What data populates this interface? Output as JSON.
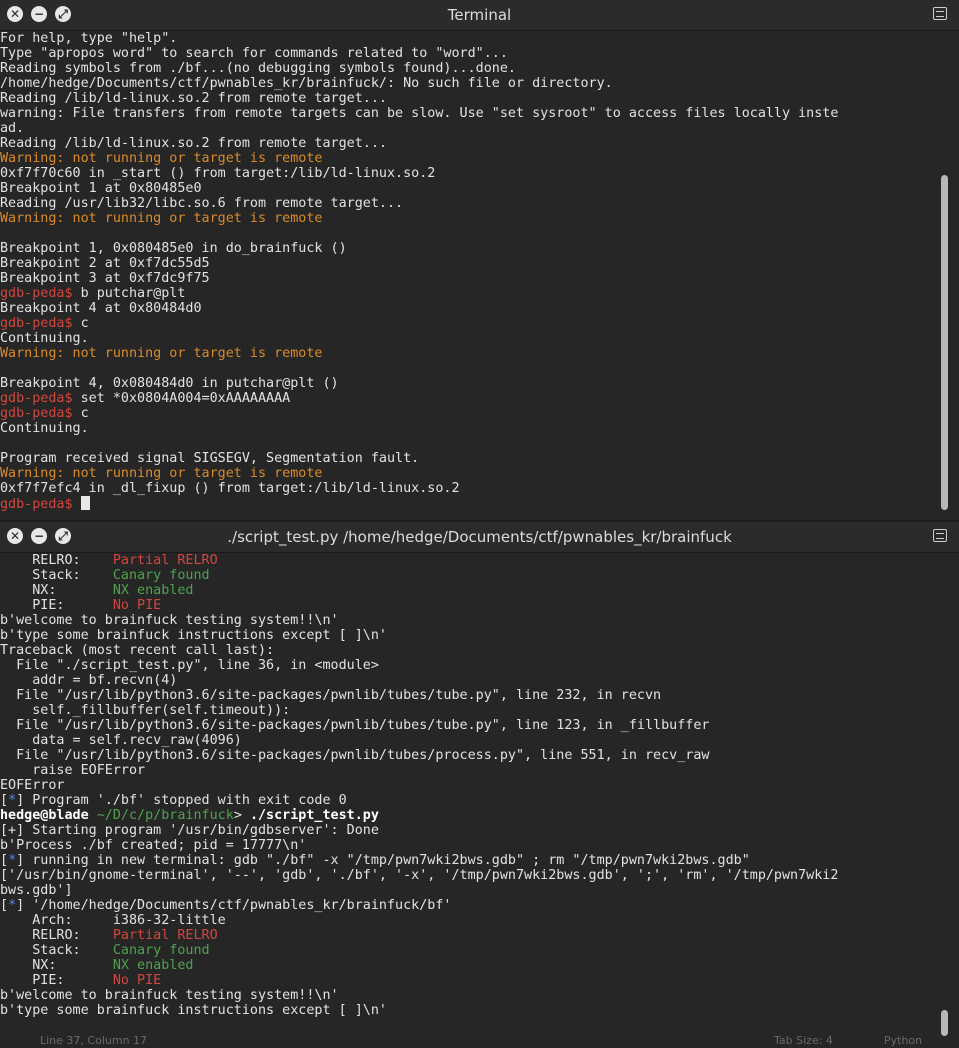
{
  "window1": {
    "title": "Terminal",
    "lines": [
      [
        [
          "w",
          "For help, type \"help\"."
        ]
      ],
      [
        [
          "w",
          "Type \"apropos word\" to search for commands related to \"word\"..."
        ]
      ],
      [
        [
          "w",
          "Reading symbols from ./bf...(no debugging symbols found)...done."
        ]
      ],
      [
        [
          "w",
          "/home/hedge/Documents/ctf/pwnables_kr/brainfuck/: No such file or directory."
        ]
      ],
      [
        [
          "w",
          "Reading /lib/ld-linux.so.2 from remote target..."
        ]
      ],
      [
        [
          "w",
          "warning: File transfers from remote targets can be slow. Use \"set sysroot\" to access files locally inste"
        ]
      ],
      [
        [
          "w",
          "ad."
        ]
      ],
      [
        [
          "w",
          "Reading /lib/ld-linux.so.2 from remote target..."
        ]
      ],
      [
        [
          "o",
          "Warning: not running or target is remote"
        ]
      ],
      [
        [
          "w",
          "0xf7f70c60 in _start () from target:/lib/ld-linux.so.2"
        ]
      ],
      [
        [
          "w",
          "Breakpoint 1 at 0x80485e0"
        ]
      ],
      [
        [
          "w",
          "Reading /usr/lib32/libc.so.6 from remote target..."
        ]
      ],
      [
        [
          "o",
          "Warning: not running or target is remote"
        ]
      ],
      [
        [
          "w",
          ""
        ]
      ],
      [
        [
          "w",
          "Breakpoint 1, 0x080485e0 in do_brainfuck ()"
        ]
      ],
      [
        [
          "w",
          "Breakpoint 2 at 0xf7dc55d5"
        ]
      ],
      [
        [
          "w",
          "Breakpoint 3 at 0xf7dc9f75"
        ]
      ],
      [
        [
          "r",
          "gdb-peda$ "
        ],
        [
          "w",
          "b putchar@plt"
        ]
      ],
      [
        [
          "w",
          "Breakpoint 4 at 0x80484d0"
        ]
      ],
      [
        [
          "r",
          "gdb-peda$ "
        ],
        [
          "w",
          "c"
        ]
      ],
      [
        [
          "w",
          "Continuing."
        ]
      ],
      [
        [
          "o",
          "Warning: not running or target is remote"
        ]
      ],
      [
        [
          "w",
          ""
        ]
      ],
      [
        [
          "w",
          "Breakpoint 4, 0x080484d0 in putchar@plt ()"
        ]
      ],
      [
        [
          "r",
          "gdb-peda$ "
        ],
        [
          "w",
          "set *0x0804A004=0xAAAAAAAA"
        ]
      ],
      [
        [
          "r",
          "gdb-peda$ "
        ],
        [
          "w",
          "c"
        ]
      ],
      [
        [
          "w",
          "Continuing."
        ]
      ],
      [
        [
          "w",
          ""
        ]
      ],
      [
        [
          "w",
          "Program received signal SIGSEGV, Segmentation fault."
        ]
      ],
      [
        [
          "o",
          "Warning: not running or target is remote"
        ]
      ],
      [
        [
          "w",
          "0xf7f7efc4 in _dl_fixup () from target:/lib/ld-linux.so.2"
        ]
      ],
      [
        [
          "r",
          "gdb-peda$ "
        ]
      ]
    ]
  },
  "window2": {
    "title": "./script_test.py  /home/hedge/Documents/ctf/pwnables_kr/brainfuck",
    "lines": [
      [
        [
          "w",
          "    RELRO:    "
        ],
        [
          "r",
          "Partial RELRO"
        ]
      ],
      [
        [
          "w",
          "    Stack:    "
        ],
        [
          "g",
          "Canary found"
        ]
      ],
      [
        [
          "w",
          "    NX:       "
        ],
        [
          "g",
          "NX enabled"
        ]
      ],
      [
        [
          "w",
          "    PIE:      "
        ],
        [
          "r",
          "No PIE"
        ]
      ],
      [
        [
          "w",
          "b'welcome to brainfuck testing system!!\\n'"
        ]
      ],
      [
        [
          "w",
          "b'type some brainfuck instructions except [ ]\\n'"
        ]
      ],
      [
        [
          "w",
          "Traceback (most recent call last):"
        ]
      ],
      [
        [
          "w",
          "  File \"./script_test.py\", line 36, in <module>"
        ]
      ],
      [
        [
          "w",
          "    addr = bf.recvn(4)"
        ]
      ],
      [
        [
          "w",
          "  File \"/usr/lib/python3.6/site-packages/pwnlib/tubes/tube.py\", line 232, in recvn"
        ]
      ],
      [
        [
          "w",
          "    self._fillbuffer(self.timeout)):"
        ]
      ],
      [
        [
          "w",
          "  File \"/usr/lib/python3.6/site-packages/pwnlib/tubes/tube.py\", line 123, in _fillbuffer"
        ]
      ],
      [
        [
          "w",
          "    data = self.recv_raw(4096)"
        ]
      ],
      [
        [
          "w",
          "  File \"/usr/lib/python3.6/site-packages/pwnlib/tubes/process.py\", line 551, in recv_raw"
        ]
      ],
      [
        [
          "w",
          "    raise EOFError"
        ]
      ],
      [
        [
          "w",
          "EOFError"
        ]
      ],
      [
        [
          "w",
          "["
        ],
        [
          "b",
          "*"
        ],
        [
          "w",
          "] Program './bf' stopped with exit code 0"
        ]
      ],
      [
        [
          "bold",
          "hedge@blade "
        ],
        [
          "g",
          "~/D/c/p/brainfuck"
        ],
        [
          "w",
          "> "
        ],
        [
          "bold",
          "./script_test.py"
        ]
      ],
      [
        [
          "w",
          "[+] Starting program '/usr/bin/gdbserver': Done"
        ]
      ],
      [
        [
          "w",
          "b'Process ./bf created; pid = 17777\\n'"
        ]
      ],
      [
        [
          "w",
          "["
        ],
        [
          "b",
          "*"
        ],
        [
          "w",
          "] running in new terminal: gdb \"./bf\" -x \"/tmp/pwn7wki2bws.gdb\" ; rm \"/tmp/pwn7wki2bws.gdb\""
        ]
      ],
      [
        [
          "w",
          "['/usr/bin/gnome-terminal', '--', 'gdb', './bf', '-x', '/tmp/pwn7wki2bws.gdb', ';', 'rm', '/tmp/pwn7wki2"
        ]
      ],
      [
        [
          "w",
          "bws.gdb']"
        ]
      ],
      [
        [
          "w",
          "["
        ],
        [
          "b",
          "*"
        ],
        [
          "w",
          "] '/home/hedge/Documents/ctf/pwnables_kr/brainfuck/bf'"
        ]
      ],
      [
        [
          "w",
          "    Arch:     i386-32-little"
        ]
      ],
      [
        [
          "w",
          "    RELRO:    "
        ],
        [
          "r",
          "Partial RELRO"
        ]
      ],
      [
        [
          "w",
          "    Stack:    "
        ],
        [
          "g",
          "Canary found"
        ]
      ],
      [
        [
          "w",
          "    NX:       "
        ],
        [
          "g",
          "NX enabled"
        ]
      ],
      [
        [
          "w",
          "    PIE:      "
        ],
        [
          "r",
          "No PIE"
        ]
      ],
      [
        [
          "w",
          "b'welcome to brainfuck testing system!!\\n'"
        ]
      ],
      [
        [
          "w",
          "b'type some brainfuck instructions except [ ]\\n'"
        ]
      ]
    ]
  },
  "statusbar": {
    "position": "Line 37, Column 17",
    "tab_size": "Tab Size: 4",
    "language": "Python"
  },
  "icons": {
    "close": "close-icon",
    "minimize": "minimize-icon",
    "maximize": "maximize-icon",
    "menu": "menu-icon"
  }
}
